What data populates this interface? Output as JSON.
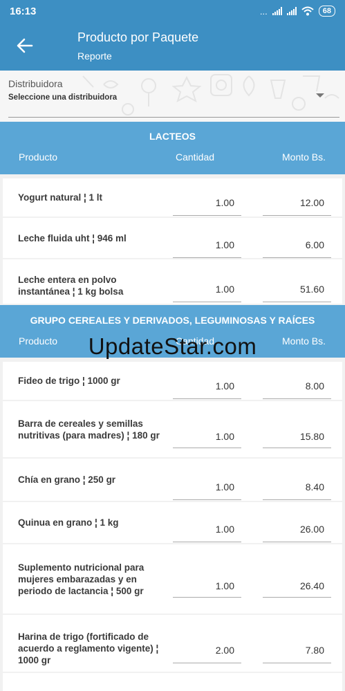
{
  "status": {
    "time": "16:13",
    "dots": "...",
    "battery": "68"
  },
  "appbar": {
    "title": "Producto por Paquete",
    "subtitle": "Reporte"
  },
  "filter": {
    "label": "Distribuidora",
    "selected": "Seleccione una distribuidora"
  },
  "columns": {
    "product": "Producto",
    "quantity": "Cantidad",
    "amount": "Monto Bs."
  },
  "section1": {
    "title": "LACTEOS",
    "rows": [
      {
        "name": "Yogurt natural ¦ 1 lt",
        "qty": "1.00",
        "amount": "12.00"
      },
      {
        "name": "Leche fluida uht ¦ 946 ml",
        "qty": "1.00",
        "amount": "6.00"
      },
      {
        "name": "Leche entera en polvo instantánea ¦ 1 kg bolsa",
        "qty": "1.00",
        "amount": "51.60"
      }
    ]
  },
  "section2": {
    "title": "GRUPO CEREALES Y DERIVADOS, LEGUMINOSAS Y RAÍCES",
    "rows": [
      {
        "name": "Fideo de trigo ¦ 1000 gr",
        "qty": "1.00",
        "amount": "8.00"
      },
      {
        "name": "Barra de cereales y semillas nutritivas (para madres) ¦ 180 gr",
        "qty": "1.00",
        "amount": "15.80"
      },
      {
        "name": "Chía en grano ¦ 250 gr",
        "qty": "1.00",
        "amount": "8.40"
      },
      {
        "name": "Quinua en grano ¦ 1 kg",
        "qty": "1.00",
        "amount": "26.00"
      },
      {
        "name": "Suplemento nutricional para mujeres embarazadas y en periodo de lactancia ¦ 500 gr",
        "qty": "1.00",
        "amount": "26.40"
      },
      {
        "name": "Harina de trigo (fortificado de acuerdo a reglamento vigente) ¦ 1000 gr",
        "qty": "2.00",
        "amount": "7.80"
      }
    ]
  },
  "watermark": "UpdateStar.com",
  "colors": {
    "primary": "#3d8fc3",
    "section_header": "#5aa6d6",
    "background": "#f1f1f1"
  }
}
